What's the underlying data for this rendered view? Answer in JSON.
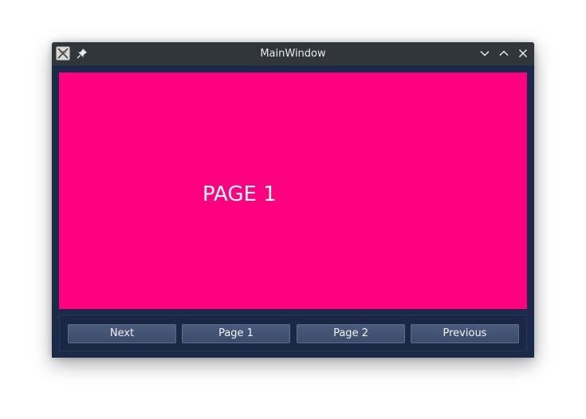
{
  "window": {
    "title": "MainWindow"
  },
  "content": {
    "page_label": "PAGE 1",
    "page_color": "#ff0080"
  },
  "buttons": {
    "next": "Next",
    "page1": "Page 1",
    "page2": "Page 2",
    "previous": "Previous"
  },
  "icons": {
    "app": "app-icon",
    "pin": "pin-icon",
    "minimize": "chevron-down-icon",
    "maximize": "chevron-up-icon",
    "close": "close-icon"
  }
}
